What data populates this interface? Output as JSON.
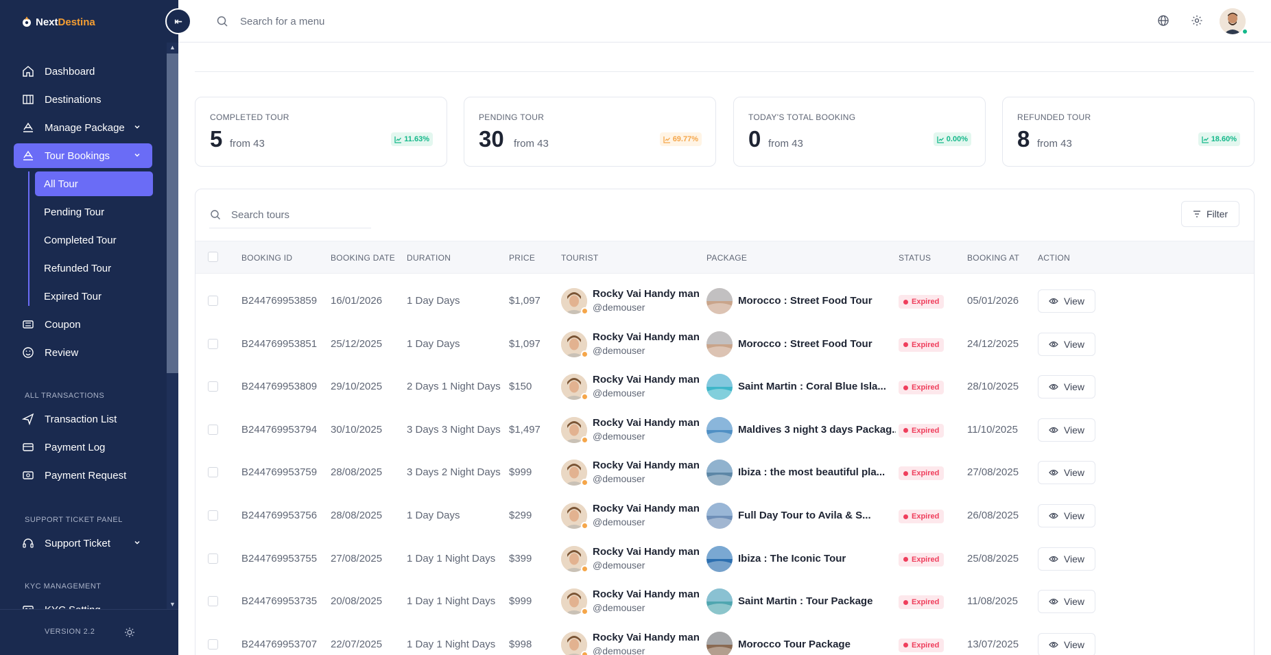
{
  "brand": {
    "part1": "Next",
    "part2": "Destina"
  },
  "topbar": {
    "search_placeholder": "Search for a menu"
  },
  "sidebar": {
    "items": [
      {
        "label": "Dashboard",
        "icon": "home-icon"
      },
      {
        "label": "Destinations",
        "icon": "columns-icon"
      },
      {
        "label": "Manage Package",
        "icon": "package-icon"
      },
      {
        "label": "Tour Bookings",
        "icon": "bookings-icon"
      }
    ],
    "sub_items": [
      "All Tour",
      "Pending Tour",
      "Completed Tour",
      "Refunded Tour",
      "Expired Tour"
    ],
    "items_after": [
      {
        "label": "Coupon",
        "icon": "ticket-icon"
      },
      {
        "label": "Review",
        "icon": "smile-icon"
      }
    ],
    "sections": [
      {
        "label": "ALL TRANSACTIONS",
        "items": [
          "Transaction List",
          "Payment Log",
          "Payment Request"
        ]
      },
      {
        "label": "SUPPORT TICKET PANEL",
        "items": [
          "Support Ticket"
        ]
      },
      {
        "label": "KYC MANAGEMENT",
        "items": [
          "KYC Setting"
        ]
      }
    ],
    "version": "VERSION 2.2"
  },
  "stats": [
    {
      "label": "COMPLETED TOUR",
      "value": "5",
      "from": "from 43",
      "change": "11.63%",
      "tone": "green"
    },
    {
      "label": "PENDING TOUR",
      "value": "30",
      "from": "from 43",
      "change": "69.77%",
      "tone": "orange"
    },
    {
      "label": "TODAY'S TOTAL BOOKING",
      "value": "0",
      "from": "from 43",
      "change": "0.00%",
      "tone": "green"
    },
    {
      "label": "REFUNDED TOUR",
      "value": "8",
      "from": "from 43",
      "change": "18.60%",
      "tone": "green"
    }
  ],
  "table": {
    "search_placeholder": "Search tours",
    "filter_label": "Filter",
    "view_label": "View",
    "columns": [
      "BOOKING ID",
      "BOOKING DATE",
      "DURATION",
      "PRICE",
      "TOURIST",
      "PACKAGE",
      "STATUS",
      "BOOKING AT",
      "ACTION"
    ],
    "rows": [
      {
        "id": "B244769953859",
        "date": "16/01/2026",
        "duration": "1 Day Days",
        "price": "$1,097",
        "tourist": "Rocky Vai Handy man",
        "handle": "@demouser",
        "package": "Morocco : Street Food Tour",
        "status": "Expired",
        "booked_at": "05/01/2026",
        "pkg_color": "#c9a48a"
      },
      {
        "id": "B244769953851",
        "date": "25/12/2025",
        "duration": "1 Day Days",
        "price": "$1,097",
        "tourist": "Rocky Vai Handy man",
        "handle": "@demouser",
        "package": "Morocco : Street Food Tour",
        "status": "Expired",
        "booked_at": "24/12/2025",
        "pkg_color": "#c9a48a"
      },
      {
        "id": "B244769953809",
        "date": "29/10/2025",
        "duration": "2 Days 1 Night Days",
        "price": "$150",
        "tourist": "Rocky Vai Handy man",
        "handle": "@demouser",
        "package": "Saint Martin : Coral Blue Isla...",
        "status": "Expired",
        "booked_at": "28/10/2025",
        "pkg_color": "#3fb6c9"
      },
      {
        "id": "B244769953794",
        "date": "30/10/2025",
        "duration": "3 Days 3 Night Days",
        "price": "$1,497",
        "tourist": "Rocky Vai Handy man",
        "handle": "@demouser",
        "package": "Maldives 3 night 3 days Packag...",
        "status": "Expired",
        "booked_at": "11/10/2025",
        "pkg_color": "#4f8fc4"
      },
      {
        "id": "B244769953759",
        "date": "28/08/2025",
        "duration": "3 Days 2 Night Days",
        "price": "$999",
        "tourist": "Rocky Vai Handy man",
        "handle": "@demouser",
        "package": "Ibiza : the most beautiful pla...",
        "status": "Expired",
        "booked_at": "27/08/2025",
        "pkg_color": "#5c86a6"
      },
      {
        "id": "B244769953756",
        "date": "28/08/2025",
        "duration": "1 Day Days",
        "price": "$299",
        "tourist": "Rocky Vai Handy man",
        "handle": "@demouser",
        "package": "Full Day Tour to Avila & S...",
        "status": "Expired",
        "booked_at": "26/08/2025",
        "pkg_color": "#6f8fb8"
      },
      {
        "id": "B244769953755",
        "date": "27/08/2025",
        "duration": "1 Day 1 Night Days",
        "price": "$399",
        "tourist": "Rocky Vai Handy man",
        "handle": "@demouser",
        "package": "Ibiza : The Iconic Tour",
        "status": "Expired",
        "booked_at": "25/08/2025",
        "pkg_color": "#2c6fb0"
      },
      {
        "id": "B244769953735",
        "date": "20/08/2025",
        "duration": "1 Day 1 Night Days",
        "price": "$999",
        "tourist": "Rocky Vai Handy man",
        "handle": "@demouser",
        "package": "Saint Martin : Tour Package",
        "status": "Expired",
        "booked_at": "11/08/2025",
        "pkg_color": "#4fa6b0"
      },
      {
        "id": "B244769953707",
        "date": "22/07/2025",
        "duration": "1 Day 1 Night Days",
        "price": "$998",
        "tourist": "Rocky Vai Handy man",
        "handle": "@demouser",
        "package": "Morocco Tour Package",
        "status": "Expired",
        "booked_at": "13/07/2025",
        "pkg_color": "#8a6a52"
      }
    ]
  }
}
